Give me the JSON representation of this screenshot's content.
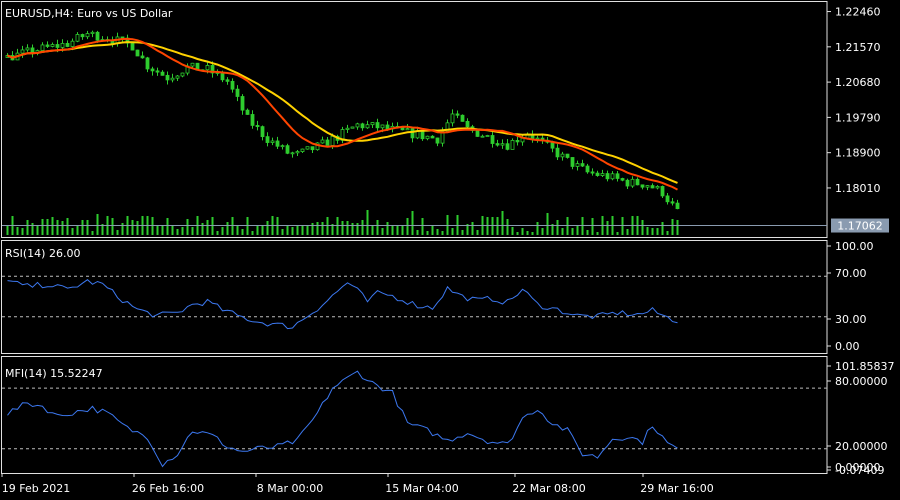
{
  "chart_data": {
    "type": "candlestick",
    "symbol": "EURUSD",
    "timeframe": "H4",
    "description": "Euro vs US Dollar",
    "current_price": "1.17062",
    "price_ticks": [
      "1.22460",
      "1.21570",
      "1.20680",
      "1.19790",
      "1.18900",
      "1.18010"
    ],
    "price_range": [
      1.1705,
      1.226
    ],
    "x_tick_labels": [
      "19 Feb 2021",
      "26 Feb 16:00",
      "8 Mar 00:00",
      "15 Mar 04:00",
      "22 Mar 08:00",
      "29 Mar 16:00"
    ],
    "price_anchors": [
      [
        0,
        1.213
      ],
      [
        6,
        1.215
      ],
      [
        12,
        1.2165
      ],
      [
        16,
        1.219
      ],
      [
        20,
        1.218
      ],
      [
        25,
        1.216
      ],
      [
        28,
        1.211
      ],
      [
        32,
        1.208
      ],
      [
        36,
        1.2105
      ],
      [
        40,
        1.21
      ],
      [
        44,
        1.207
      ],
      [
        48,
        1.1975
      ],
      [
        52,
        1.1925
      ],
      [
        56,
        1.189
      ],
      [
        58,
        1.1885
      ],
      [
        62,
        1.1905
      ],
      [
        66,
        1.193
      ],
      [
        70,
        1.196
      ],
      [
        74,
        1.1955
      ],
      [
        78,
        1.1945
      ],
      [
        82,
        1.1935
      ],
      [
        86,
        1.1925
      ],
      [
        89,
        1.1985
      ],
      [
        92,
        1.195
      ],
      [
        96,
        1.193
      ],
      [
        100,
        1.191
      ],
      [
        104,
        1.194
      ],
      [
        108,
        1.1905
      ],
      [
        112,
        1.187
      ],
      [
        116,
        1.184
      ],
      [
        120,
        1.183
      ],
      [
        124,
        1.1815
      ],
      [
        128,
        1.181
      ],
      [
        131,
        1.179
      ],
      [
        134,
        1.174
      ]
    ],
    "moving_averages": [
      {
        "color": "#ffd200",
        "period": 21
      },
      {
        "color": "#ff4500",
        "period": 13
      }
    ],
    "indicators": [
      {
        "name": "RSI(14)",
        "value": "26.00",
        "ticks": [
          "100.00",
          "70.00",
          "30.00",
          "0.00"
        ],
        "levels": [
          70,
          30
        ],
        "range": [
          0,
          100
        ],
        "anchors": [
          [
            0,
            65
          ],
          [
            4,
            60
          ],
          [
            8,
            62
          ],
          [
            12,
            57
          ],
          [
            16,
            65
          ],
          [
            19,
            62
          ],
          [
            22,
            50
          ],
          [
            26,
            37
          ],
          [
            30,
            31
          ],
          [
            34,
            34
          ],
          [
            37,
            42
          ],
          [
            40,
            45
          ],
          [
            43,
            37
          ],
          [
            46,
            31
          ],
          [
            50,
            25
          ],
          [
            54,
            22
          ],
          [
            57,
            20
          ],
          [
            60,
            31
          ],
          [
            63,
            42
          ],
          [
            66,
            55
          ],
          [
            68,
            64
          ],
          [
            70,
            56
          ],
          [
            72,
            45
          ],
          [
            74,
            53
          ],
          [
            76,
            52
          ],
          [
            79,
            47
          ],
          [
            82,
            41
          ],
          [
            85,
            39
          ],
          [
            88,
            58
          ],
          [
            91,
            50
          ],
          [
            94,
            46
          ],
          [
            97,
            48
          ],
          [
            100,
            44
          ],
          [
            103,
            57
          ],
          [
            106,
            42
          ],
          [
            110,
            37
          ],
          [
            114,
            31
          ],
          [
            118,
            30
          ],
          [
            122,
            34
          ],
          [
            126,
            32
          ],
          [
            129,
            36
          ],
          [
            132,
            29
          ],
          [
            134,
            26
          ]
        ]
      },
      {
        "name": "MFI(14)",
        "value": "15.52247",
        "ticks": [
          "101.85837",
          "80.00000",
          "20.00000",
          "0.00000",
          "-0.07409"
        ],
        "levels": [
          80,
          20
        ],
        "range": [
          -0.07409,
          101.85837
        ],
        "anchors": [
          [
            0,
            55
          ],
          [
            4,
            65
          ],
          [
            7,
            62
          ],
          [
            10,
            52
          ],
          [
            14,
            57
          ],
          [
            17,
            60
          ],
          [
            20,
            55
          ],
          [
            24,
            40
          ],
          [
            28,
            32
          ],
          [
            31,
            5
          ],
          [
            34,
            15
          ],
          [
            37,
            38
          ],
          [
            41,
            33
          ],
          [
            44,
            22
          ],
          [
            47,
            17
          ],
          [
            50,
            20
          ],
          [
            54,
            22
          ],
          [
            58,
            28
          ],
          [
            62,
            55
          ],
          [
            65,
            80
          ],
          [
            70,
            96
          ],
          [
            73,
            85
          ],
          [
            77,
            75
          ],
          [
            80,
            45
          ],
          [
            84,
            38
          ],
          [
            88,
            28
          ],
          [
            92,
            36
          ],
          [
            96,
            28
          ],
          [
            100,
            24
          ],
          [
            103,
            50
          ],
          [
            106,
            60
          ],
          [
            109,
            45
          ],
          [
            112,
            38
          ],
          [
            115,
            15
          ],
          [
            118,
            12
          ],
          [
            121,
            30
          ],
          [
            124,
            32
          ],
          [
            127,
            27
          ],
          [
            129,
            44
          ],
          [
            132,
            25
          ],
          [
            134,
            20
          ]
        ]
      }
    ]
  }
}
